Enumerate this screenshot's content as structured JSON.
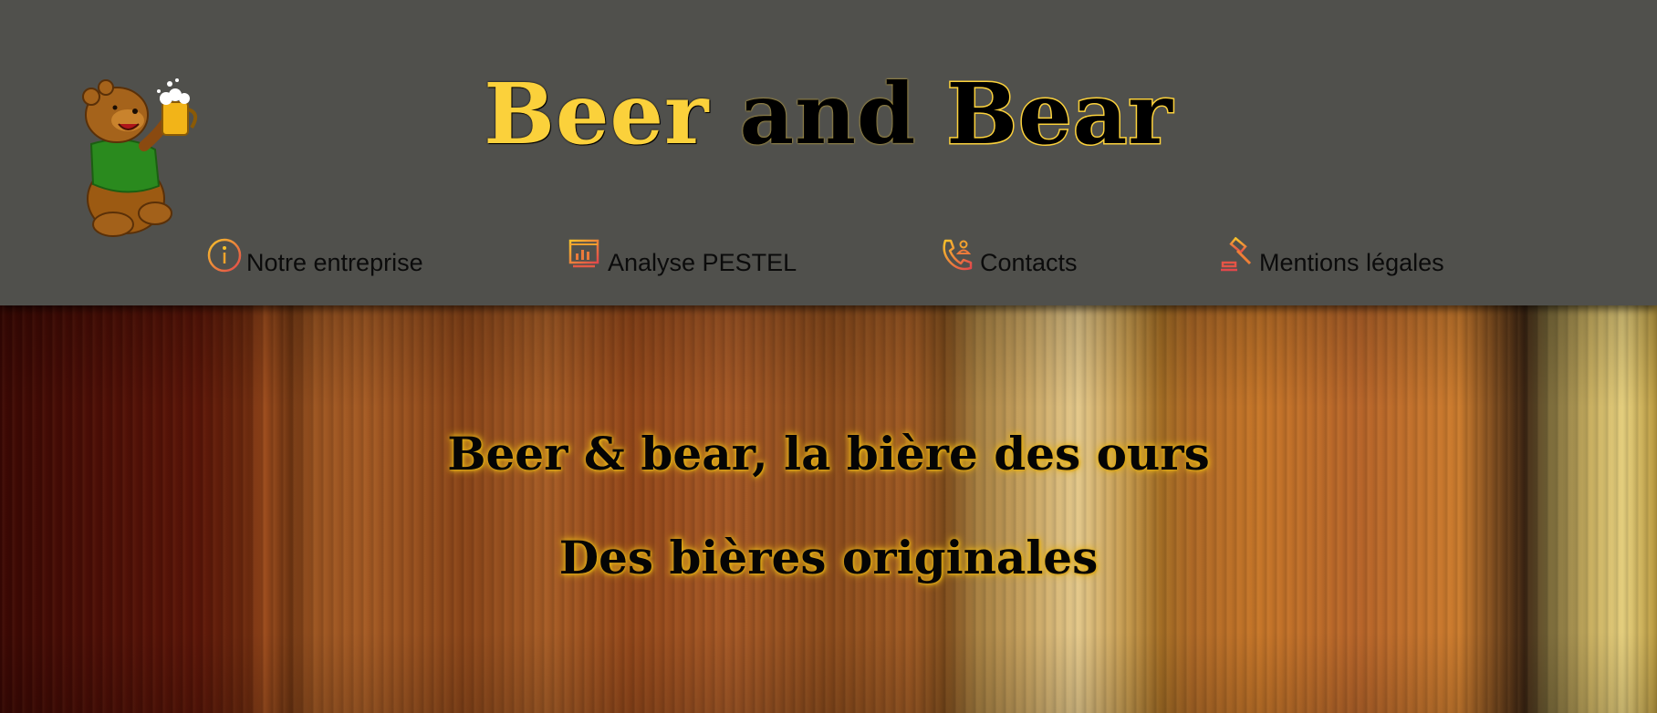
{
  "header": {
    "logo_icon": "bear-with-beer-mug-icon",
    "title": {
      "part1": "Beer",
      "part2": "and",
      "part3": "Bear"
    },
    "colors": {
      "background": "#50504c",
      "accent": "#fbd13b",
      "icon_gradient_start": "#f7c22a",
      "icon_gradient_end": "#e2474b"
    }
  },
  "nav": {
    "items": [
      {
        "label": "Notre entreprise",
        "icon": "info-circle-icon"
      },
      {
        "label": "Analyse PESTEL",
        "icon": "presentation-board-icon"
      },
      {
        "label": "Contacts",
        "icon": "phone-contact-icon"
      },
      {
        "label": "Mentions légales",
        "icon": "gavel-icon"
      }
    ]
  },
  "hero": {
    "background": "wooden-barrel-image",
    "line1": "Beer & bear, la bière des ours",
    "line2": "Des bières originales"
  }
}
